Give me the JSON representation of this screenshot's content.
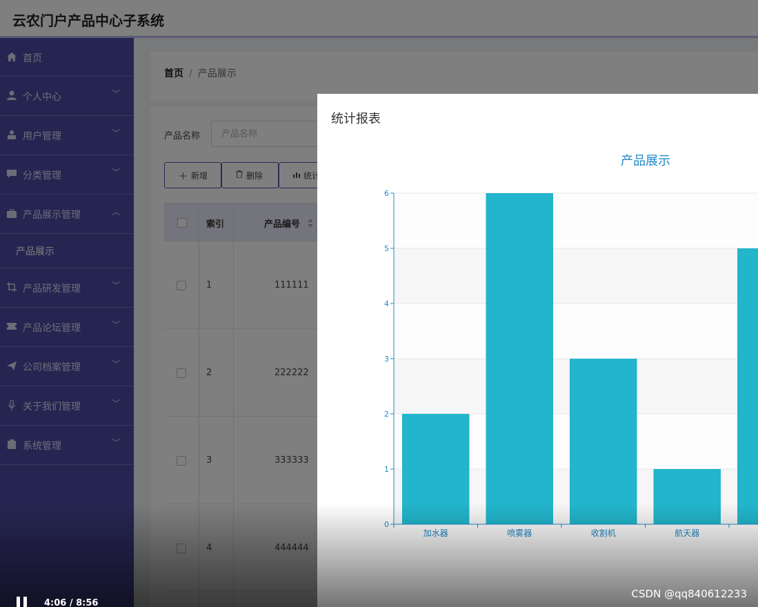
{
  "app": {
    "title": "云农门户产品中心子系统"
  },
  "sidebar": {
    "items": [
      {
        "label": "首页",
        "icon": "home-icon",
        "expandable": false
      },
      {
        "label": "个人中心",
        "icon": "user-icon",
        "expandable": true
      },
      {
        "label": "用户管理",
        "icon": "user-admin-icon",
        "expandable": true
      },
      {
        "label": "分类管理",
        "icon": "chat-icon",
        "expandable": true
      },
      {
        "label": "产品展示管理",
        "icon": "briefcase-icon",
        "expandable": true,
        "expanded": true,
        "children": [
          {
            "label": "产品展示"
          }
        ]
      },
      {
        "label": "产品研发管理",
        "icon": "crop-icon",
        "expandable": true
      },
      {
        "label": "产品论坛管理",
        "icon": "ticket-icon",
        "expandable": true
      },
      {
        "label": "公司档案管理",
        "icon": "send-icon",
        "expandable": true
      },
      {
        "label": "关于我们管理",
        "icon": "microphone-icon",
        "expandable": true
      },
      {
        "label": "系统管理",
        "icon": "clipboard-icon",
        "expandable": true
      }
    ]
  },
  "breadcrumb": {
    "home": "首页",
    "separator": "/",
    "current": "产品展示"
  },
  "search": {
    "label": "产品名称",
    "placeholder": "产品名称"
  },
  "toolbar": {
    "add_label": "新增",
    "delete_label": "删除",
    "stats_label": "统计"
  },
  "table": {
    "headers": {
      "index": "索引",
      "code": "产品编号"
    },
    "rows": [
      {
        "index": "1",
        "code": "111111"
      },
      {
        "index": "2",
        "code": "222222"
      },
      {
        "index": "3",
        "code": "333333"
      },
      {
        "index": "4",
        "code": "444444"
      }
    ]
  },
  "dialog": {
    "title": "统计报表"
  },
  "chart_data": {
    "type": "bar",
    "title": "产品展示",
    "categories": [
      "加水器",
      "喷雾器",
      "收割机",
      "航天器"
    ],
    "values": [
      2,
      6,
      3,
      1
    ],
    "partial_next_value": 5,
    "ylim": [
      0,
      6
    ],
    "yticks": [
      "0",
      "1",
      "2",
      "3",
      "4",
      "5",
      "6"
    ],
    "xlabel": "",
    "ylabel": "",
    "grid": true,
    "bar_color": "#22b5cc",
    "axis_color": "#1e88c7"
  },
  "video": {
    "time": "4:06 / 8:56"
  },
  "watermark": {
    "text": "CSDN @qq840612233"
  },
  "colors": {
    "sidebar": "#4c4aa4",
    "header_border": "#b9b8f1",
    "accent": "#5553b0"
  }
}
